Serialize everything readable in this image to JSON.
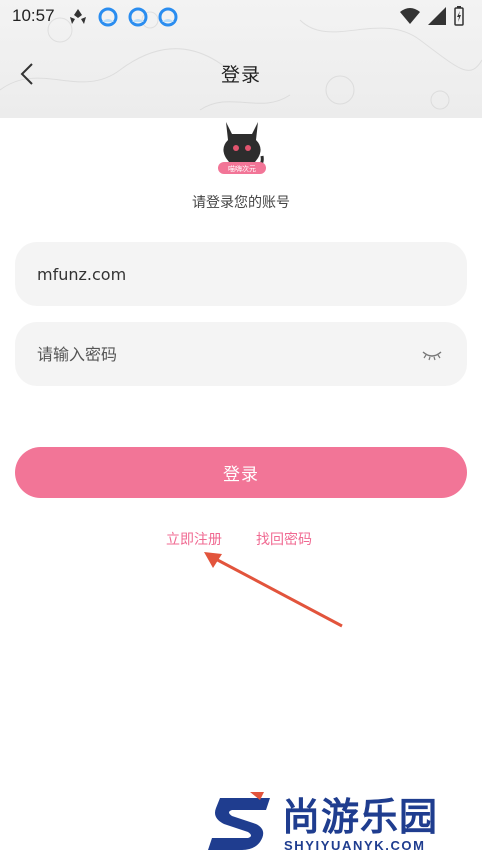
{
  "status_bar": {
    "time": "10:57",
    "left_icons": [
      "wind-icon",
      "app-notify-icon",
      "app-notify-icon",
      "app-notify-icon"
    ],
    "right_icons": [
      "wifi-icon",
      "signal-icon",
      "battery-icon"
    ]
  },
  "nav": {
    "back_icon": "chevron-left-icon",
    "title": "登录"
  },
  "avatar": {
    "badge_text": "喵嗨次元"
  },
  "subtitle": "请登录您的账号",
  "form": {
    "username_value": "mfunz.com",
    "password_placeholder": "请输入密码",
    "password_toggle_icon": "eye-closed-icon",
    "login_label": "登录"
  },
  "links": {
    "register": "立即注册",
    "forgot": "找回密码"
  },
  "watermark": {
    "cn": "尚游乐园",
    "en": "SHYIYUANYK.COM"
  },
  "colors": {
    "accent": "#f27597",
    "link": "#f06a92",
    "field_bg": "#f4f4f4",
    "annotation_arrow": "#e2543c",
    "watermark": "#1f3d8f"
  }
}
